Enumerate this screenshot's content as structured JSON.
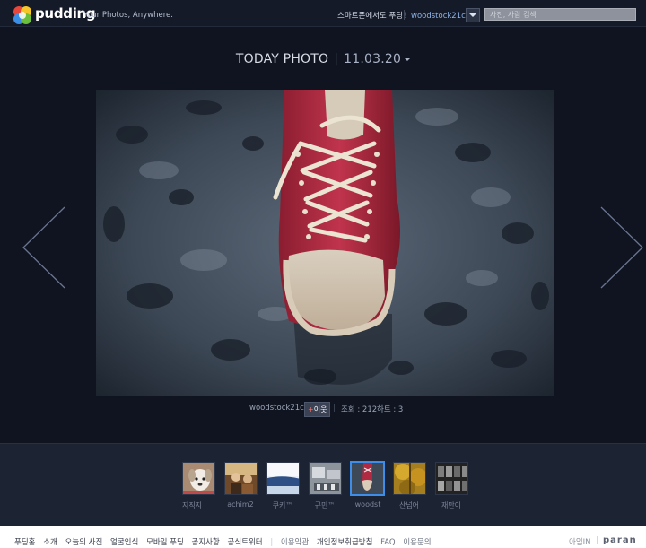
{
  "header": {
    "brand": "pudding",
    "tagline": "Your Photos, Anywhere.",
    "smartphone_link": "스마트폰에서도 푸딩!",
    "user_link": "woodstock21c님",
    "search_placeholder": "사진, 사람 검색"
  },
  "today": {
    "title": "TODAY PHOTO",
    "separator": "|",
    "date": "11.03.20"
  },
  "photo_meta": {
    "author": "woodstock21c",
    "neighbor_plus": "+",
    "neighbor_label": "이웃",
    "separator": "|",
    "views": "조회 : 212",
    "hearts": "하트 : 3"
  },
  "thumbnails": [
    {
      "label": "지직지",
      "selected": false
    },
    {
      "label": "achim2",
      "selected": false
    },
    {
      "label": "쿠키™",
      "selected": false
    },
    {
      "label": "규민™",
      "selected": false
    },
    {
      "label": "woodst",
      "selected": true
    },
    {
      "label": "산넘어",
      "selected": false
    },
    {
      "label": "재만이",
      "selected": false
    }
  ],
  "footer": {
    "nav": [
      "푸딩홈",
      "소개",
      "오늘의 사진",
      "얼굴인식",
      "모바일 푸딩",
      "공지사항",
      "공식트위터"
    ],
    "separator": "|",
    "policy": [
      "이용약관",
      "개인정보취급방침",
      "FAQ",
      "이용문의"
    ],
    "login": "아임IN",
    "paran": "paran"
  },
  "colors": {
    "background": "#0f1420",
    "topbar": "#141a28",
    "strip": "#1c2333",
    "accent_blue": "#3e8de8",
    "shoe_red": "#b22a42"
  }
}
